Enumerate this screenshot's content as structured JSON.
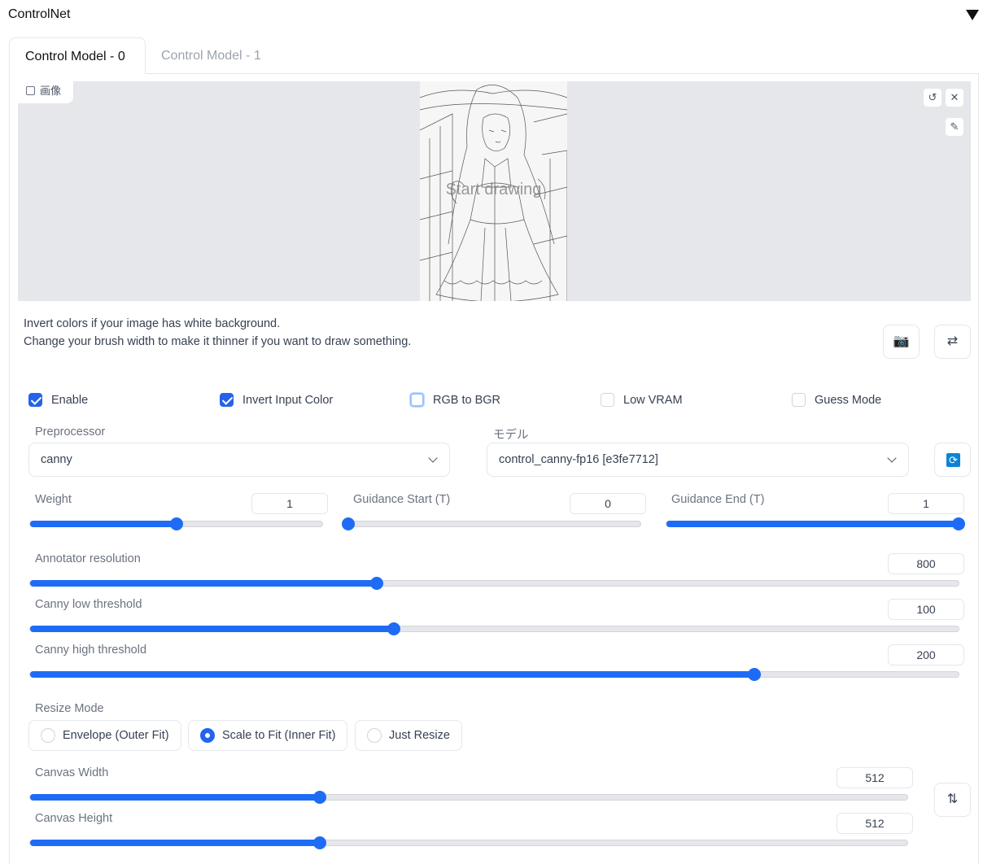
{
  "panel": {
    "title": "ControlNet"
  },
  "tabs": [
    {
      "label": "Control Model - 0"
    },
    {
      "label": "Control Model - 1"
    }
  ],
  "image": {
    "label": "画像",
    "placeholder": "Start drawing"
  },
  "hints": [
    "Invert colors if your image has white background.",
    "Change your brush width to make it thinner if you want to draw something."
  ],
  "checkboxes": [
    {
      "label": "Enable",
      "checked": true
    },
    {
      "label": "Invert Input Color",
      "checked": true
    },
    {
      "label": "RGB to BGR",
      "checked": false
    },
    {
      "label": "Low VRAM",
      "checked": false
    },
    {
      "label": "Guess Mode",
      "checked": false
    }
  ],
  "preprocessor": {
    "label": "Preprocessor",
    "value": "canny"
  },
  "model": {
    "label": "モデル",
    "value": "control_canny-fp16 [e3fe7712]"
  },
  "sliders": {
    "weight": {
      "label": "Weight",
      "value": "1",
      "fraction": 0.5
    },
    "guidance_start": {
      "label": "Guidance Start (T)",
      "value": "0",
      "fraction": 0.0
    },
    "guidance_end": {
      "label": "Guidance End (T)",
      "value": "1",
      "fraction": 1.0
    },
    "annotator_resolution": {
      "label": "Annotator resolution",
      "value": "800",
      "fraction": 0.373
    },
    "canny_low": {
      "label": "Canny low threshold",
      "value": "100",
      "fraction": 0.392
    },
    "canny_high": {
      "label": "Canny high threshold",
      "value": "200",
      "fraction": 0.78
    },
    "canvas_width": {
      "label": "Canvas Width",
      "value": "512",
      "fraction": 0.33
    },
    "canvas_height": {
      "label": "Canvas Height",
      "value": "512",
      "fraction": 0.33
    }
  },
  "resize_mode": {
    "label": "Resize Mode",
    "options": [
      {
        "label": "Envelope (Outer Fit)",
        "selected": false
      },
      {
        "label": "Scale to Fit (Inner Fit)",
        "selected": true
      },
      {
        "label": "Just Resize",
        "selected": false
      }
    ]
  },
  "colors": {
    "accent": "#1e6cf5",
    "border": "#e5e7eb",
    "image_bg": "#e5e7eb"
  }
}
